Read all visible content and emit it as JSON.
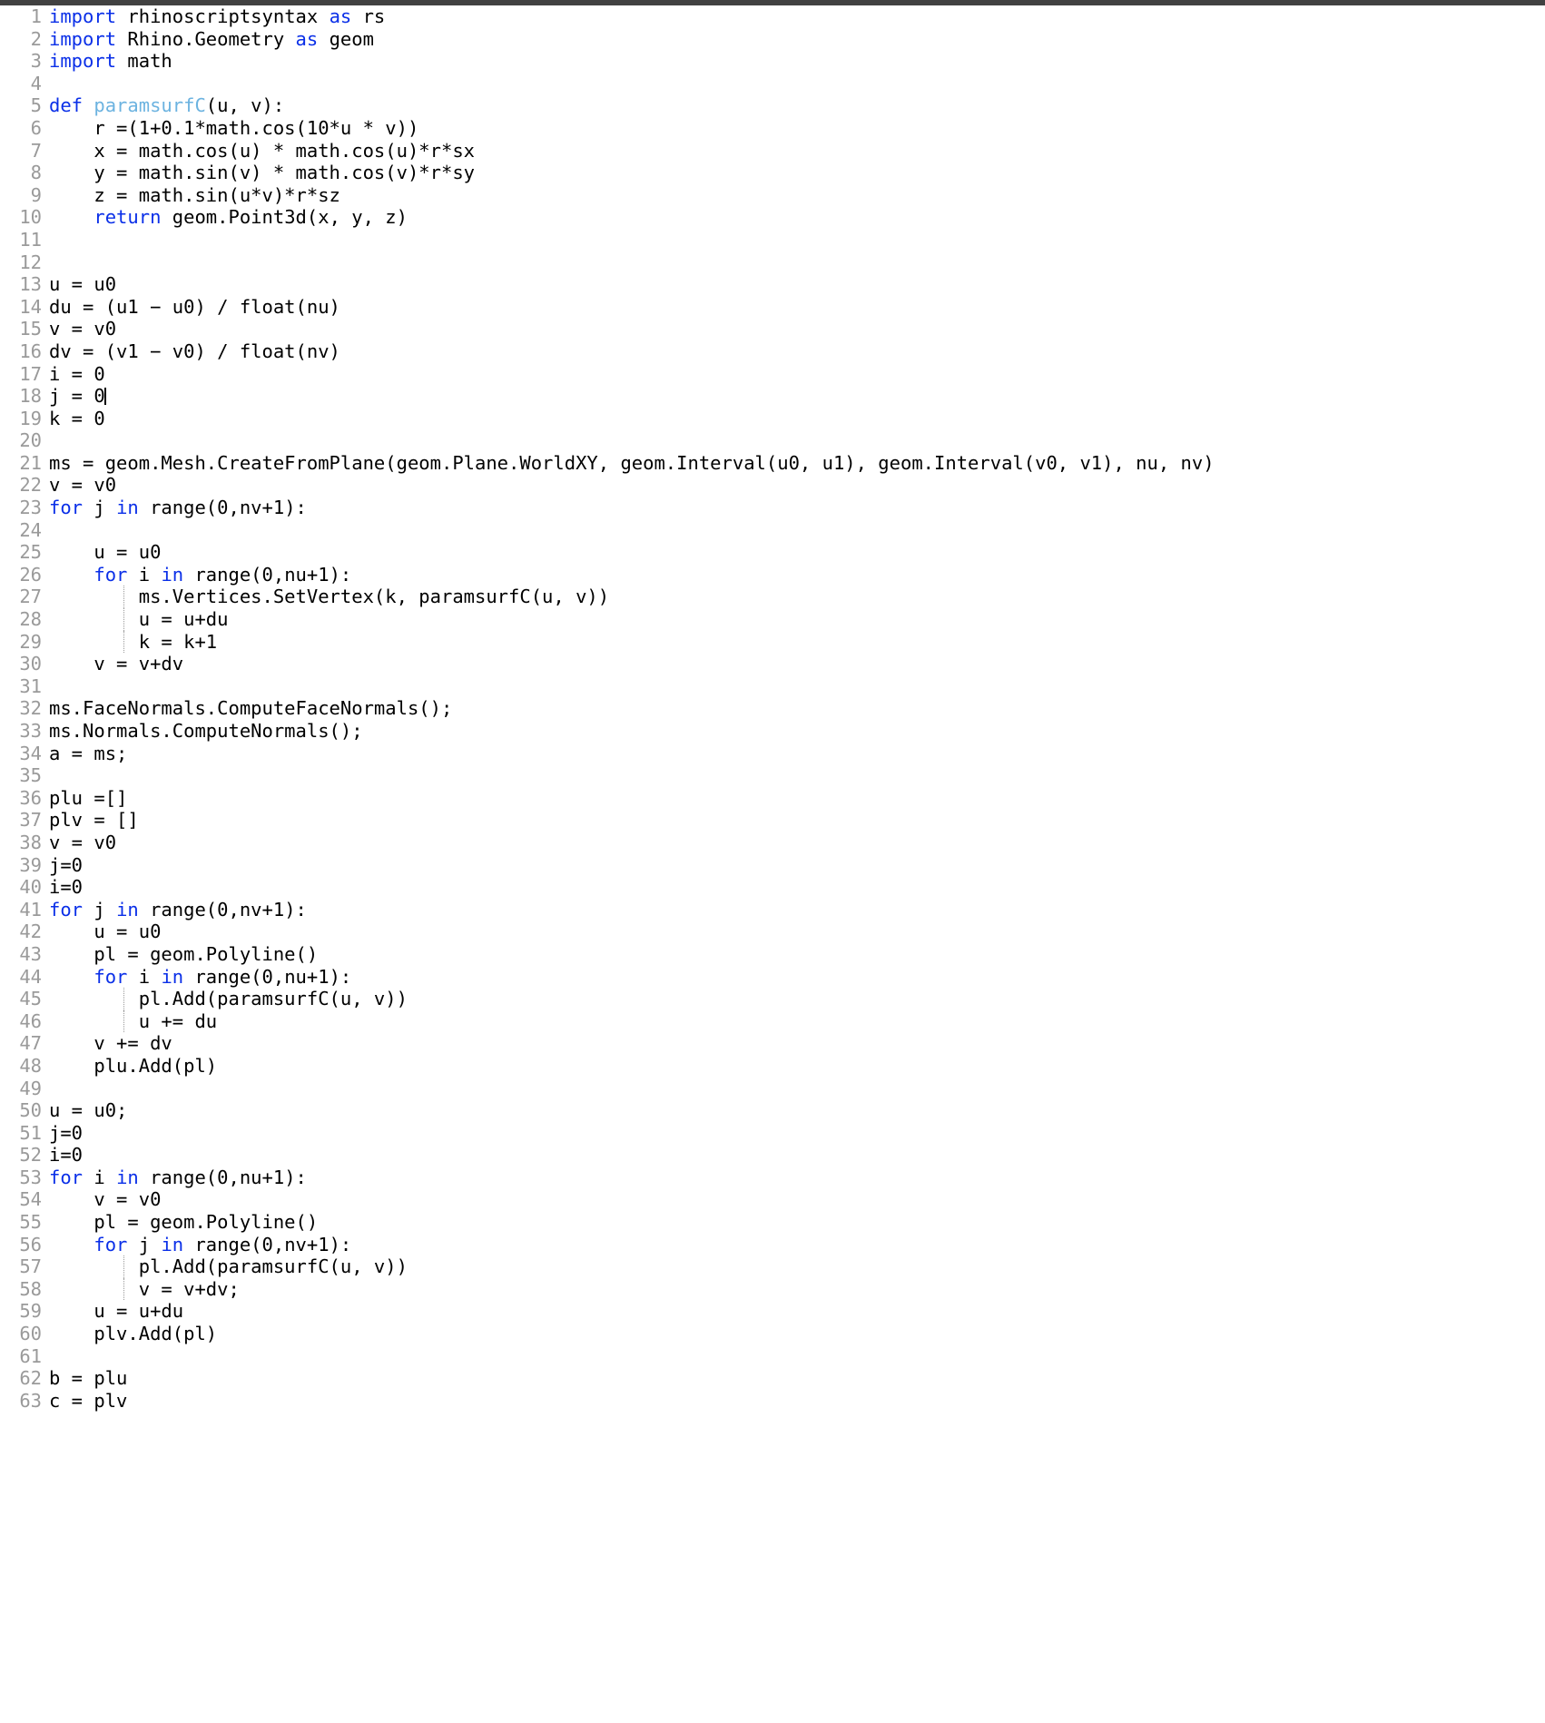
{
  "window": {
    "titlebar_color": "#414141",
    "background_color": "#ffffff"
  },
  "editor": {
    "language": "Python",
    "gutter_color": "#9a9a9a",
    "text_color": "#000000",
    "keyword_color": "#0a2fe8",
    "function_name_color": "#6cb3e0",
    "indent_guide_color": "#9a9a9a",
    "cursor_line": 18,
    "cursor_column": 6,
    "total_lines": 63,
    "lines": [
      {
        "n": "1",
        "tokens": [
          {
            "t": "import",
            "c": "kw"
          },
          {
            "t": " rhinoscriptsyntax ",
            "c": "pl"
          },
          {
            "t": "as",
            "c": "kw"
          },
          {
            "t": " rs",
            "c": "pl"
          }
        ]
      },
      {
        "n": "2",
        "tokens": [
          {
            "t": "import",
            "c": "kw"
          },
          {
            "t": " Rhino.Geometry ",
            "c": "pl"
          },
          {
            "t": "as",
            "c": "kw"
          },
          {
            "t": " geom",
            "c": "pl"
          }
        ]
      },
      {
        "n": "3",
        "tokens": [
          {
            "t": "import",
            "c": "kw"
          },
          {
            "t": " math",
            "c": "pl"
          }
        ]
      },
      {
        "n": "4",
        "tokens": []
      },
      {
        "n": "5",
        "tokens": [
          {
            "t": "def",
            "c": "kw"
          },
          {
            "t": " ",
            "c": "pl"
          },
          {
            "t": "paramsurfC",
            "c": "fn"
          },
          {
            "t": "(u, v):",
            "c": "pl"
          }
        ]
      },
      {
        "n": "6",
        "tokens": [
          {
            "t": "    r =(1+0.1*math.cos(10*u * v))",
            "c": "pl"
          }
        ]
      },
      {
        "n": "7",
        "tokens": [
          {
            "t": "    x = math.cos(u) * math.cos(u)*r*sx",
            "c": "pl"
          }
        ]
      },
      {
        "n": "8",
        "tokens": [
          {
            "t": "    y = math.sin(v) * math.cos(v)*r*sy",
            "c": "pl"
          }
        ]
      },
      {
        "n": "9",
        "tokens": [
          {
            "t": "    z = math.sin(u*v)*r*sz",
            "c": "pl"
          }
        ]
      },
      {
        "n": "10",
        "tokens": [
          {
            "t": "    ",
            "c": "pl"
          },
          {
            "t": "return",
            "c": "kw"
          },
          {
            "t": " geom.Point3d(x, y, z)",
            "c": "pl"
          }
        ]
      },
      {
        "n": "11",
        "tokens": []
      },
      {
        "n": "12",
        "tokens": []
      },
      {
        "n": "13",
        "tokens": [
          {
            "t": "u = u0",
            "c": "pl"
          }
        ]
      },
      {
        "n": "14",
        "tokens": [
          {
            "t": "du = (u1 − u0) / float(nu)",
            "c": "pl"
          }
        ]
      },
      {
        "n": "15",
        "tokens": [
          {
            "t": "v = v0",
            "c": "pl"
          }
        ]
      },
      {
        "n": "16",
        "tokens": [
          {
            "t": "dv = (v1 − v0) / float(nv)",
            "c": "pl"
          }
        ]
      },
      {
        "n": "17",
        "tokens": [
          {
            "t": "i = 0",
            "c": "pl"
          }
        ]
      },
      {
        "n": "18",
        "tokens": [
          {
            "t": "j = 0",
            "c": "pl"
          }
        ],
        "cursor": true
      },
      {
        "n": "19",
        "tokens": [
          {
            "t": "k = 0",
            "c": "pl"
          }
        ]
      },
      {
        "n": "20",
        "tokens": []
      },
      {
        "n": "21",
        "tokens": [
          {
            "t": "ms = geom.Mesh.CreateFromPlane(geom.Plane.WorldXY, geom.Interval(u0, u1), geom.Interval(v0, v1), nu, nv)",
            "c": "pl"
          }
        ]
      },
      {
        "n": "22",
        "tokens": [
          {
            "t": "v = v0",
            "c": "pl"
          }
        ]
      },
      {
        "n": "23",
        "tokens": [
          {
            "t": "for",
            "c": "kw"
          },
          {
            "t": " j ",
            "c": "pl"
          },
          {
            "t": "in",
            "c": "kw"
          },
          {
            "t": " range(0,nv+1):",
            "c": "pl"
          }
        ]
      },
      {
        "n": "24",
        "tokens": []
      },
      {
        "n": "25",
        "tokens": [
          {
            "t": "    u = u0",
            "c": "pl"
          }
        ]
      },
      {
        "n": "26",
        "tokens": [
          {
            "t": "    ",
            "c": "pl"
          },
          {
            "t": "for",
            "c": "kw"
          },
          {
            "t": " i ",
            "c": "pl"
          },
          {
            "t": "in",
            "c": "kw"
          },
          {
            "t": " range(0,nu+1):",
            "c": "pl"
          }
        ]
      },
      {
        "n": "27",
        "tokens": [
          {
            "t": "        ms.Vertices.SetVertex(k, paramsurfC(u, v))",
            "c": "pl"
          }
        ],
        "guides": [
          1
        ]
      },
      {
        "n": "28",
        "tokens": [
          {
            "t": "        u = u+du",
            "c": "pl"
          }
        ],
        "guides": [
          1
        ]
      },
      {
        "n": "29",
        "tokens": [
          {
            "t": "        k = k+1",
            "c": "pl"
          }
        ],
        "guides": [
          1
        ]
      },
      {
        "n": "30",
        "tokens": [
          {
            "t": "    v = v+dv",
            "c": "pl"
          }
        ]
      },
      {
        "n": "31",
        "tokens": []
      },
      {
        "n": "32",
        "tokens": [
          {
            "t": "ms.FaceNormals.ComputeFaceNormals();",
            "c": "pl"
          }
        ]
      },
      {
        "n": "33",
        "tokens": [
          {
            "t": "ms.Normals.ComputeNormals();",
            "c": "pl"
          }
        ]
      },
      {
        "n": "34",
        "tokens": [
          {
            "t": "a = ms;",
            "c": "pl"
          }
        ]
      },
      {
        "n": "35",
        "tokens": []
      },
      {
        "n": "36",
        "tokens": [
          {
            "t": "plu =[]",
            "c": "pl"
          }
        ]
      },
      {
        "n": "37",
        "tokens": [
          {
            "t": "plv = []",
            "c": "pl"
          }
        ]
      },
      {
        "n": "38",
        "tokens": [
          {
            "t": "v = v0",
            "c": "pl"
          }
        ]
      },
      {
        "n": "39",
        "tokens": [
          {
            "t": "j=0",
            "c": "pl"
          }
        ]
      },
      {
        "n": "40",
        "tokens": [
          {
            "t": "i=0",
            "c": "pl"
          }
        ]
      },
      {
        "n": "41",
        "tokens": [
          {
            "t": "for",
            "c": "kw"
          },
          {
            "t": " j ",
            "c": "pl"
          },
          {
            "t": "in",
            "c": "kw"
          },
          {
            "t": " range(0,nv+1):",
            "c": "pl"
          }
        ]
      },
      {
        "n": "42",
        "tokens": [
          {
            "t": "    u = u0",
            "c": "pl"
          }
        ]
      },
      {
        "n": "43",
        "tokens": [
          {
            "t": "    pl = geom.Polyline()",
            "c": "pl"
          }
        ]
      },
      {
        "n": "44",
        "tokens": [
          {
            "t": "    ",
            "c": "pl"
          },
          {
            "t": "for",
            "c": "kw"
          },
          {
            "t": " i ",
            "c": "pl"
          },
          {
            "t": "in",
            "c": "kw"
          },
          {
            "t": " range(0,nu+1):",
            "c": "pl"
          }
        ]
      },
      {
        "n": "45",
        "tokens": [
          {
            "t": "        pl.Add(paramsurfC(u, v))",
            "c": "pl"
          }
        ],
        "guides": [
          1
        ]
      },
      {
        "n": "46",
        "tokens": [
          {
            "t": "        u += du",
            "c": "pl"
          }
        ],
        "guides": [
          1
        ]
      },
      {
        "n": "47",
        "tokens": [
          {
            "t": "    v += dv",
            "c": "pl"
          }
        ]
      },
      {
        "n": "48",
        "tokens": [
          {
            "t": "    plu.Add(pl)",
            "c": "pl"
          }
        ]
      },
      {
        "n": "49",
        "tokens": []
      },
      {
        "n": "50",
        "tokens": [
          {
            "t": "u = u0;",
            "c": "pl"
          }
        ]
      },
      {
        "n": "51",
        "tokens": [
          {
            "t": "j=0",
            "c": "pl"
          }
        ]
      },
      {
        "n": "52",
        "tokens": [
          {
            "t": "i=0",
            "c": "pl"
          }
        ]
      },
      {
        "n": "53",
        "tokens": [
          {
            "t": "for",
            "c": "kw"
          },
          {
            "t": " i ",
            "c": "pl"
          },
          {
            "t": "in",
            "c": "kw"
          },
          {
            "t": " range(0,nu+1):",
            "c": "pl"
          }
        ]
      },
      {
        "n": "54",
        "tokens": [
          {
            "t": "    v = v0",
            "c": "pl"
          }
        ]
      },
      {
        "n": "55",
        "tokens": [
          {
            "t": "    pl = geom.Polyline()",
            "c": "pl"
          }
        ]
      },
      {
        "n": "56",
        "tokens": [
          {
            "t": "    ",
            "c": "pl"
          },
          {
            "t": "for",
            "c": "kw"
          },
          {
            "t": " j ",
            "c": "pl"
          },
          {
            "t": "in",
            "c": "kw"
          },
          {
            "t": " range(0,nv+1):",
            "c": "pl"
          }
        ]
      },
      {
        "n": "57",
        "tokens": [
          {
            "t": "        pl.Add(paramsurfC(u, v))",
            "c": "pl"
          }
        ],
        "guides": [
          1
        ]
      },
      {
        "n": "58",
        "tokens": [
          {
            "t": "        v = v+dv;",
            "c": "pl"
          }
        ],
        "guides": [
          1
        ]
      },
      {
        "n": "59",
        "tokens": [
          {
            "t": "    u = u+du",
            "c": "pl"
          }
        ]
      },
      {
        "n": "60",
        "tokens": [
          {
            "t": "    plv.Add(pl)",
            "c": "pl"
          }
        ]
      },
      {
        "n": "61",
        "tokens": []
      },
      {
        "n": "62",
        "tokens": [
          {
            "t": "b = plu",
            "c": "pl"
          }
        ]
      },
      {
        "n": "63",
        "tokens": [
          {
            "t": "c = plv",
            "c": "pl"
          }
        ]
      }
    ]
  }
}
